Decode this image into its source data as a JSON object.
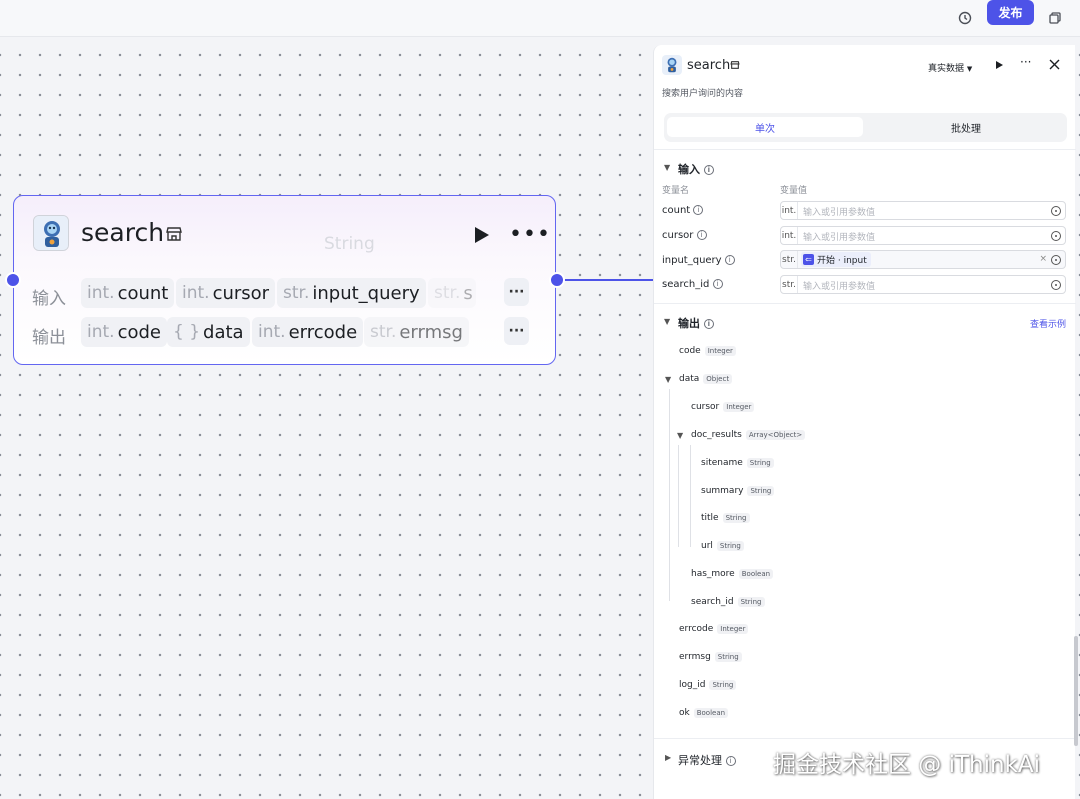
{
  "topbar": {
    "publish_label": "发布",
    "history_icon": "history-icon",
    "copy_icon": "copy-icon"
  },
  "node": {
    "title": "search",
    "ghost_text": "String",
    "input_label": "输入",
    "output_label": "输出",
    "inputs": [
      {
        "type": "int.",
        "name": "count"
      },
      {
        "type": "int.",
        "name": "cursor"
      },
      {
        "type": "str.",
        "name": "input_query"
      },
      {
        "type": "str.",
        "name": "s"
      }
    ],
    "outputs": [
      {
        "type": "int.",
        "name": "code"
      },
      {
        "type": "{ }",
        "name": "data"
      },
      {
        "type": "int.",
        "name": "errcode"
      },
      {
        "type": "str.",
        "name": "errmsg"
      }
    ],
    "more_label": "···"
  },
  "panel": {
    "title": "search",
    "description": "搜索用户询问的内容",
    "data_mode": "真实数据",
    "tabs": {
      "single": "单次",
      "batch": "批处理"
    },
    "input_section": {
      "title": "输入",
      "col_name": "变量名",
      "col_value": "变量值",
      "rows": [
        {
          "name": "count",
          "type": "int.",
          "placeholder": "输入或引用参数值"
        },
        {
          "name": "cursor",
          "type": "int.",
          "placeholder": "输入或引用参数值"
        },
        {
          "name": "input_query",
          "type": "str.",
          "ref_text": "开始 · input",
          "clear": "×"
        },
        {
          "name": "search_id",
          "type": "str.",
          "placeholder": "输入或引用参数值"
        }
      ]
    },
    "output_section": {
      "title": "输出",
      "view_example": "查看示例",
      "fields": [
        {
          "name": "code",
          "type": "Integer"
        },
        {
          "name": "data",
          "type": "Object"
        },
        {
          "name": "cursor",
          "type": "Integer"
        },
        {
          "name": "doc_results",
          "type": "Array<Object>"
        },
        {
          "name": "sitename",
          "type": "String"
        },
        {
          "name": "summary",
          "type": "String"
        },
        {
          "name": "title",
          "type": "String"
        },
        {
          "name": "url",
          "type": "String"
        },
        {
          "name": "has_more",
          "type": "Boolean"
        },
        {
          "name": "search_id",
          "type": "String"
        },
        {
          "name": "errcode",
          "type": "Integer"
        },
        {
          "name": "errmsg",
          "type": "String"
        },
        {
          "name": "log_id",
          "type": "String"
        },
        {
          "name": "ok",
          "type": "Boolean"
        }
      ]
    },
    "exception_section": {
      "title": "异常处理"
    }
  },
  "watermark": "掘金技术社区 @ iThinkAi",
  "colors": {
    "accent": "#4d53e8",
    "node_border": "#6366f1"
  }
}
